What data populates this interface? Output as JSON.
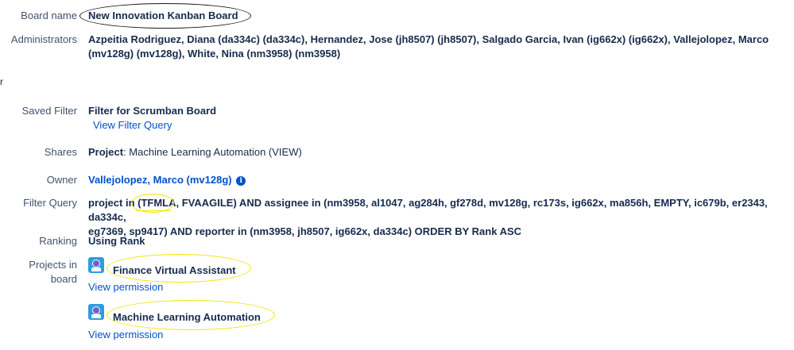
{
  "board": {
    "name_label": "Board name",
    "name_value": "New Innovation Kanban Board",
    "admins_label": "Administrators",
    "admins_line1": "Azpeitia Rodriguez, Diana (da334c) (da334c), Hernandez, Jose (jh8507) (jh8507), Salgado Garcia, Ivan (ig662x) (ig662x), Vallejolopez, Marco",
    "admins_line2": "(mv128g) (mv128g), White, Nina (nm3958) (nm3958)",
    "stray_char": "r"
  },
  "filter": {
    "saved_label": "Saved Filter",
    "saved_value": "Filter for Scrumban Board",
    "view_query_link": "View Filter Query",
    "shares_label": "Shares",
    "shares_prefix": "Project",
    "shares_value": ": Machine Learning Automation (VIEW)",
    "owner_label": "Owner",
    "owner_value": "Vallejolopez, Marco (mv128g)",
    "query_label": "Filter Query",
    "query_line1": "project in (TFMLA, FVAAGILE) AND assignee in (nm3958, al1047, ag284h, gf278d, mv128g, rc173s, ig662x, ma856h, EMPTY, ic679b, er2343, da334c,",
    "query_line2": "eg7369, sp9417) AND reporter in (nm3958, jh8507, ig662x, da334c) ORDER BY Rank ASC",
    "ranking_label": "Ranking",
    "ranking_value": "Using Rank"
  },
  "projects": {
    "label": "Projects in board",
    "items": [
      {
        "name": "Finance Virtual Assistant",
        "permission_link": "View permission"
      },
      {
        "name": "Machine Learning Automation",
        "permission_link": "View permission"
      }
    ]
  },
  "icons": {
    "info": "info-icon",
    "project": "project-avatar-icon"
  },
  "colors": {
    "link": "#0052cc",
    "label": "#42526e",
    "text": "#172b4d",
    "highlight": "#f2e600"
  }
}
